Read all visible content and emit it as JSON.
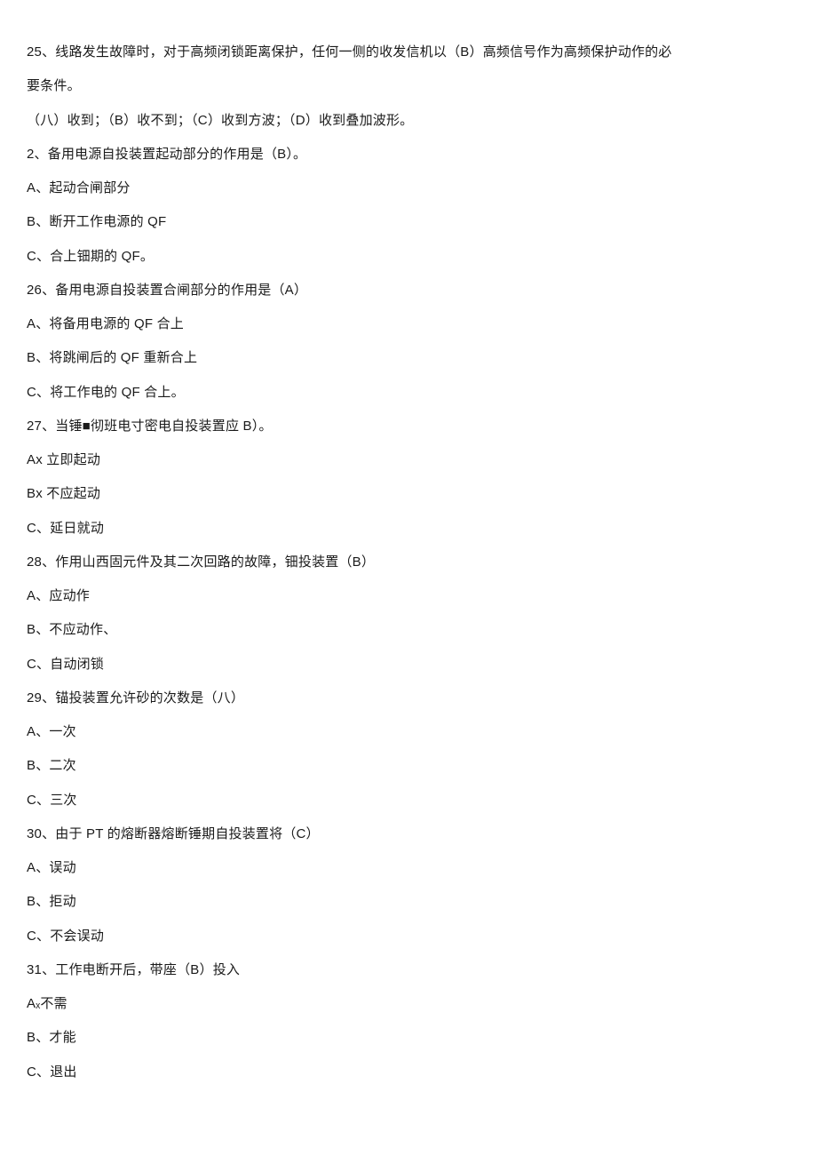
{
  "lines": [
    "25、线路发生故障时，对于高频闭锁距离保护，任何一侧的收发信机以（B）高频信号作为高频保护动作的必",
    "要条件。",
    "（八）收到；（B）收不到；（C）收到方波；（D）收到叠加波形。",
    "2、备用电源自投装置起动部分的作用是（B）。",
    "A、起动合闸部分",
    "B、断开工作电源的 QF",
    "C、合上钿期的 QF。",
    "26、备用电源自投装置合闸部分的作用是（A）",
    "A、将备用电源的 QF 合上",
    "B、将跳闸后的 QF 重新合上",
    "C、将工作电的 QF 合上。",
    "27、当锤■彻班电寸密电自投装置应 B）。",
    "Ax 立即起动",
    "Bx 不应起动",
    "C、延日就动",
    "28、作用山西固元件及其二次回路的故障，钿投装置（B）",
    "A、应动作",
    "B、不应动作、",
    "C、自动闭锁",
    "29、锚投装置允许砂的次数是（八）",
    "A、一次",
    "B、二次",
    "C、三次",
    "30、由于 PT 的熔断器熔断锤期自投装置将（C）",
    "A、误动",
    "B、拒动",
    "C、不会误动",
    "31、工作电断开后，带座（B）投入",
    "Aₓ不需",
    "B、才能",
    "C、退出"
  ]
}
